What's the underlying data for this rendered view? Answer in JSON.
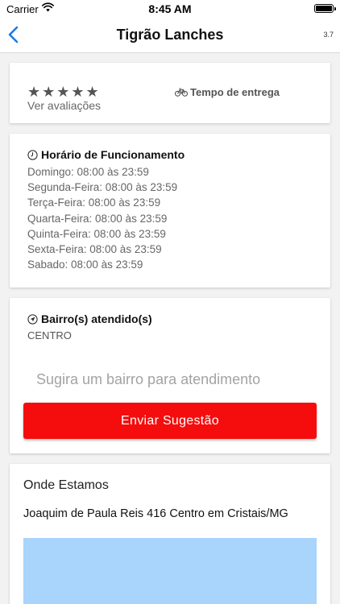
{
  "status_bar": {
    "carrier": "Carrier",
    "time": "8:45 AM"
  },
  "nav": {
    "title": "Tigrão Lanches",
    "version": "3.7"
  },
  "rating": {
    "stars": "★★★★★",
    "star_count": 5,
    "star_color": "#555555",
    "reviews_link": "Ver avaliações",
    "delivery_label": "Tempo de entrega",
    "delivery_icon": "bicycle-icon"
  },
  "hours": {
    "title": "Horário de Funcionamento",
    "title_icon": "clock-icon",
    "items": [
      "Domingo: 08:00 às 23:59",
      "Segunda-Feira: 08:00 às 23:59",
      "Terça-Feira: 08:00 às 23:59",
      "Quarta-Feira: 08:00 às 23:59",
      "Quinta-Feira: 08:00 às 23:59",
      "Sexta-Feira: 08:00 às 23:59",
      "Sabado: 08:00 às 23:59"
    ]
  },
  "neighborhoods": {
    "title": "Bairro(s) atendido(s)",
    "title_icon": "location-arrow-icon",
    "value": "CENTRO",
    "suggest_placeholder": "Sugira um bairro para atendimento",
    "suggest_value": "",
    "submit_label": "Enviar Sugestão",
    "submit_color": "#f50d0d"
  },
  "location": {
    "title": "Onde Estamos",
    "address": "Joaquim de Paula Reis 416 Centro em Cristais/MG",
    "map_color": "#a9d4fb"
  }
}
